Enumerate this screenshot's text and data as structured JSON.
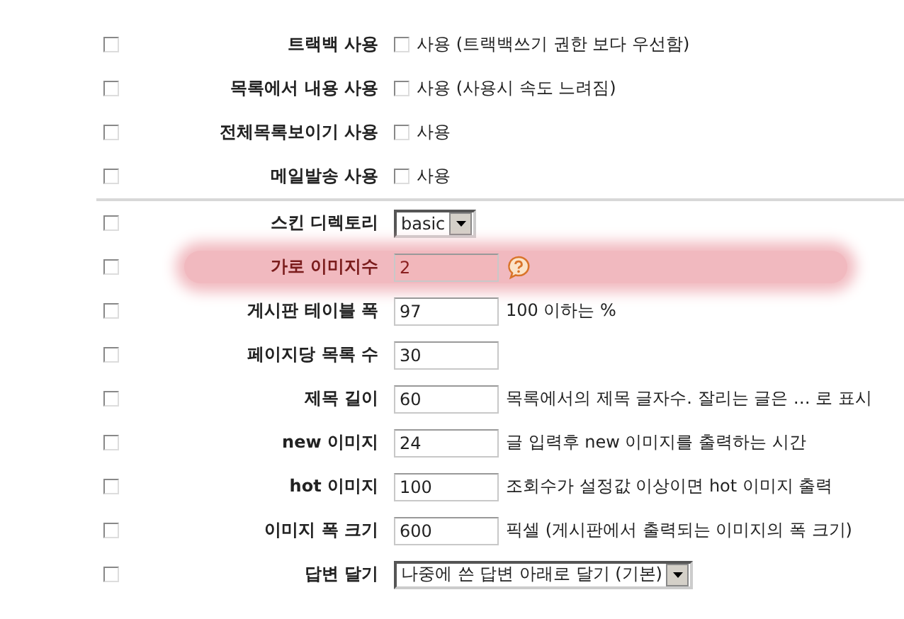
{
  "sections": [
    {
      "rows": [
        {
          "label": "트랙백 사용",
          "apply_all": false,
          "kind": "checkbox",
          "checked": false,
          "text": "사용 (트랙백쓰기 권한 보다 우선함)"
        },
        {
          "label": "목록에서 내용 사용",
          "apply_all": false,
          "kind": "checkbox",
          "checked": false,
          "text": "사용 (사용시 속도 느려짐)"
        },
        {
          "label": "전체목록보이기 사용",
          "apply_all": false,
          "kind": "checkbox",
          "checked": false,
          "text": "사용"
        },
        {
          "label": "메일발송 사용",
          "apply_all": false,
          "kind": "checkbox",
          "checked": false,
          "text": "사용"
        }
      ]
    },
    {
      "rows": [
        {
          "label": "스킨 디렉토리",
          "apply_all": false,
          "kind": "select",
          "value": "basic"
        },
        {
          "label": "가로 이미지수",
          "apply_all": false,
          "kind": "text",
          "value": "2",
          "highlighted": true,
          "help": true
        },
        {
          "label": "게시판 테이블 폭",
          "apply_all": false,
          "kind": "text",
          "value": "97",
          "note": "100 이하는 %"
        },
        {
          "label": "페이지당 목록 수",
          "apply_all": false,
          "kind": "text",
          "value": "30"
        },
        {
          "label": "제목 길이",
          "apply_all": false,
          "kind": "text",
          "value": "60",
          "note": "목록에서의 제목 글자수. 잘리는 글은 … 로 표시"
        },
        {
          "label": "new 이미지",
          "apply_all": false,
          "kind": "text",
          "value": "24",
          "note": "글 입력후 new 이미지를 출력하는 시간"
        },
        {
          "label": "hot 이미지",
          "apply_all": false,
          "kind": "text",
          "value": "100",
          "note": "조회수가 설정값 이상이면 hot 이미지 출력"
        },
        {
          "label": "이미지 폭 크기",
          "apply_all": false,
          "kind": "text",
          "value": "600",
          "note": "픽셀 (게시판에서 출력되는 이미지의 폭 크기)"
        },
        {
          "label": "답변 달기",
          "apply_all": false,
          "kind": "select",
          "value": "나중에 쓴 답변 아래로 달기 (기본)"
        }
      ]
    }
  ]
}
